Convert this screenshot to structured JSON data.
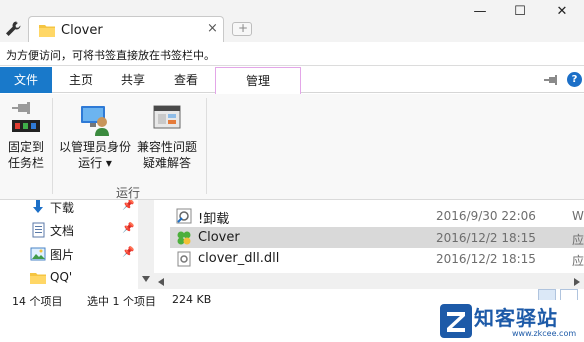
{
  "window": {
    "tab_title": "Clover",
    "tab_close": "×",
    "new_tab": "+",
    "minimize": "—",
    "maximize": "☐",
    "close": "✕"
  },
  "bookmark_bar": {
    "hint": "为方便访问，可将书签直接放在书签栏中。"
  },
  "ribbon_tabs": [
    {
      "label": "文件",
      "active": false,
      "color": "#1979ca"
    },
    {
      "label": "主页"
    },
    {
      "label": "共享"
    },
    {
      "label": "查看"
    },
    {
      "label": "管理",
      "contextual": true,
      "color": "#e3a6e8"
    }
  ],
  "ribbon": {
    "pin_taskbar": {
      "line1": "固定到",
      "line2": "任务栏",
      "icon": "pin-taskbar-icon"
    },
    "run_as_admin": {
      "line1": "以管理员身份",
      "line2": "运行 ▾",
      "icon": "run-as-admin-icon"
    },
    "compat_troubleshoot": {
      "line1": "兼容性问题",
      "line2": "疑难解答",
      "icon": "compatibility-icon"
    },
    "group_label": "运行"
  },
  "nav_pane": {
    "items": [
      {
        "label": "下载",
        "icon": "download-icon",
        "pinned": true
      },
      {
        "label": "文档",
        "icon": "documents-icon",
        "pinned": true
      },
      {
        "label": "图片",
        "icon": "pictures-icon",
        "pinned": true
      },
      {
        "label": "QQ'",
        "icon": "folder-icon",
        "pinned": false
      }
    ],
    "pin_glyph": "📌"
  },
  "files": [
    {
      "name": "!卸载",
      "date": "2016/9/30 22:06",
      "type": "W",
      "icon": "shortcut-icon",
      "selected": false
    },
    {
      "name": "Clover",
      "date": "2016/12/2 18:15",
      "type": "应",
      "icon": "clover-icon",
      "selected": true
    },
    {
      "name": "clover_dll.dll",
      "date": "2016/12/2 18:15",
      "type": "应",
      "icon": "dll-file-icon",
      "selected": false
    }
  ],
  "status_bar": {
    "item_count": "14 个项目",
    "selected": "选中 1 个项目",
    "size": "224 KB"
  },
  "watermark": {
    "brand": "知客驿站",
    "url": "www.zkcee.com",
    "logo_letter": "Z"
  },
  "colors": {
    "accent": "#1979ca",
    "selection": "#d9d9d9",
    "contextual_tab": "#e3a6e8"
  }
}
